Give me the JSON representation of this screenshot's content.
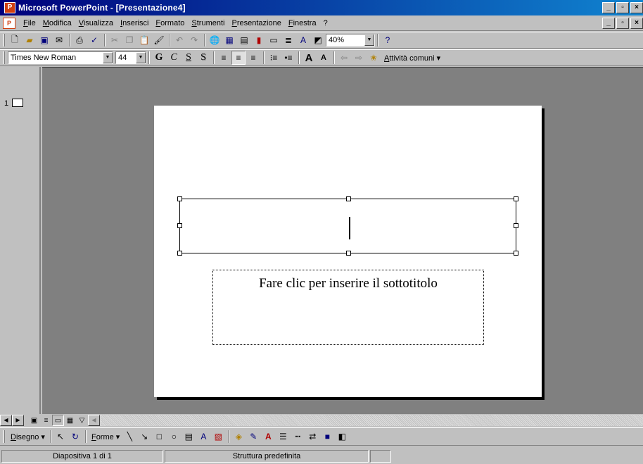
{
  "window": {
    "title": "Microsoft PowerPoint - [Presentazione4]",
    "minimize": "_",
    "maximize": "▫",
    "close": "×"
  },
  "menu": {
    "items": [
      "File",
      "Modifica",
      "Visualizza",
      "Inserisci",
      "Formato",
      "Strumenti",
      "Presentazione",
      "Finestra",
      "?"
    ]
  },
  "toolbar": {
    "zoom": "40%"
  },
  "format_toolbar": {
    "font": "Times New Roman",
    "size": "44",
    "bold": "G",
    "italic": "C",
    "underline": "S",
    "shadow": "S",
    "common_tasks": "Attività comuni ▾"
  },
  "outline": {
    "slide_number": "1"
  },
  "slide": {
    "subtitle_placeholder": "Fare clic per inserire il sottotitolo"
  },
  "drawing": {
    "draw_menu": "Disegno ▾",
    "shapes_menu": "Forme ▾"
  },
  "status": {
    "slide_info": "Diapositiva 1 di 1",
    "design": "Struttura predefinita"
  }
}
